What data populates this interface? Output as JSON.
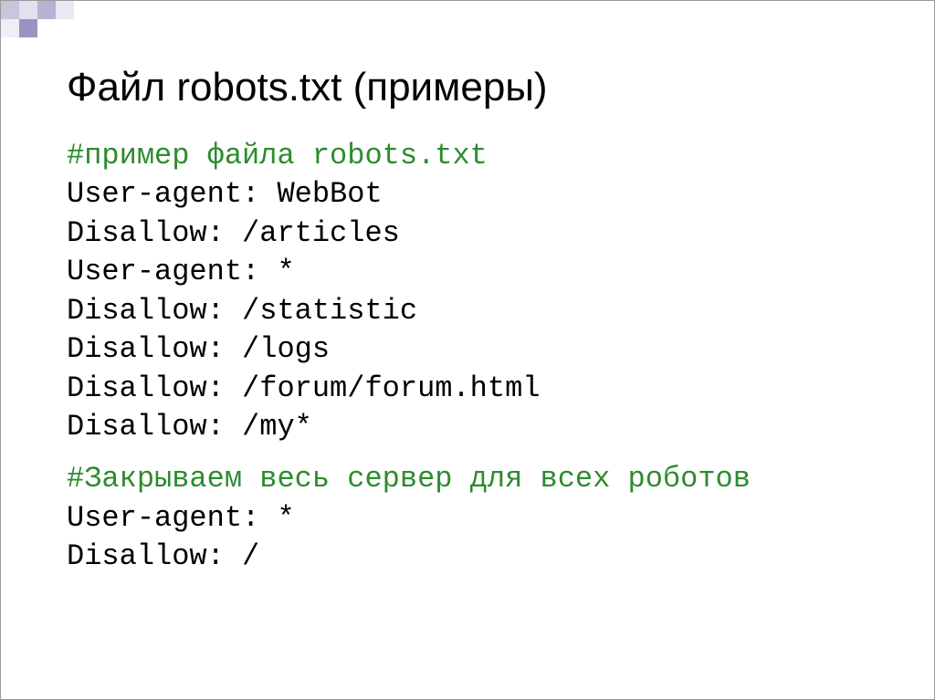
{
  "title": "Файл robots.txt (примеры)",
  "example1": {
    "comment": "#пример файла robots.txt",
    "lines": [
      "User-agent: WebBot",
      "Disallow: /articles",
      "User-agent: *",
      "Disallow: /statistic",
      "Disallow: /logs",
      "Disallow: /forum/forum.html",
      "Disallow: /my*"
    ]
  },
  "example2": {
    "comment": "#Закрываем весь сервер для всех роботов",
    "lines": [
      "User-agent: *",
      "Disallow: /"
    ]
  }
}
